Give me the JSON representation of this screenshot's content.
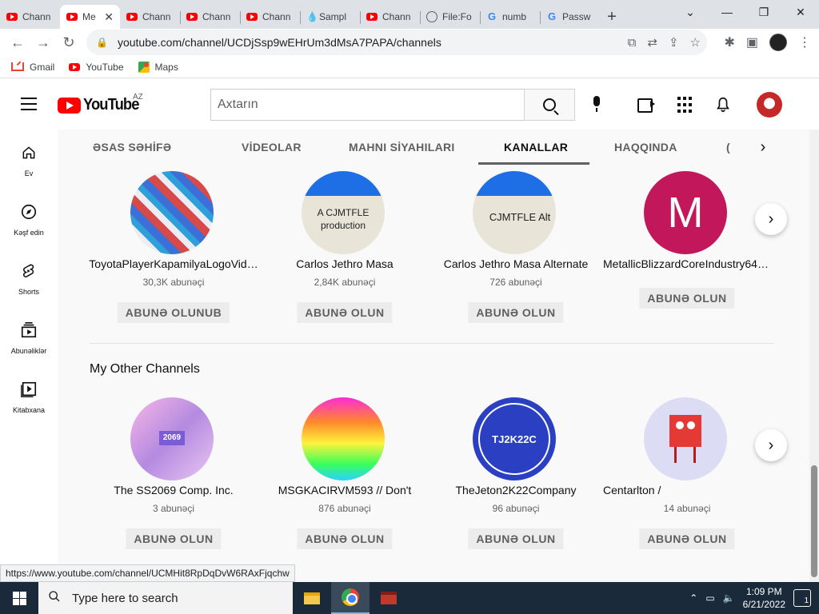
{
  "browser": {
    "tabs": [
      {
        "title": "Chann",
        "icon": "youtube-icon"
      },
      {
        "title": "Me",
        "icon": "youtube-icon",
        "active": true
      },
      {
        "title": "Chann",
        "icon": "youtube-icon"
      },
      {
        "title": "Chann",
        "icon": "youtube-icon"
      },
      {
        "title": "Chann",
        "icon": "youtube-icon"
      },
      {
        "title": "Sampl",
        "icon": "drop-icon"
      },
      {
        "title": "Chann",
        "icon": "youtube-icon"
      },
      {
        "title": "File:Fo",
        "icon": "globe-icon"
      },
      {
        "title": "numb",
        "icon": "google-icon"
      },
      {
        "title": "Passw",
        "icon": "google-icon"
      }
    ],
    "url": "youtube.com/channel/UCDjSsp9wEHrUm3dMsA7PAPA/channels",
    "bookmarks": [
      {
        "label": "Gmail"
      },
      {
        "label": "YouTube"
      },
      {
        "label": "Maps"
      }
    ],
    "status_url": "https://www.youtube.com/channel/UCMHit8RpDqDvW6RAxFjqchw"
  },
  "youtube": {
    "logo_text": "YouTube",
    "country_code": "AZ",
    "search_placeholder": "Axtarın",
    "sidebar": [
      {
        "label": "Ev",
        "icon": "home-icon"
      },
      {
        "label": "Kəşf edin",
        "icon": "compass-icon"
      },
      {
        "label": "Shorts",
        "icon": "shorts-icon"
      },
      {
        "label": "Abunəliklər",
        "icon": "subscriptions-icon"
      },
      {
        "label": "Kitabxana",
        "icon": "library-icon"
      }
    ],
    "channel_tabs": [
      {
        "label": "ƏSAS SƏHİFƏ"
      },
      {
        "label": "VİDEOLAR"
      },
      {
        "label": "MAHNI SİYAHILARI"
      },
      {
        "label": "KANALLAR",
        "active": true
      },
      {
        "label": "HAQQINDA"
      },
      {
        "label": "("
      }
    ],
    "featured_channels": [
      {
        "name": "ToyotaPlayerKapamilyaLogoVid…",
        "subs": "30,3K abunəçi",
        "button": "ABUNƏ OLUNUB",
        "thumb_text": ""
      },
      {
        "name": "Carlos Jethro Masa",
        "subs": "2,84K abunəçi",
        "button": "ABUNƏ OLUN",
        "thumb_text": "A CJMTFLE production"
      },
      {
        "name": "Carlos Jethro Masa Alternate",
        "subs": "726 abunəçi",
        "button": "ABUNƏ OLUN",
        "thumb_text": "CJMTFLE Alt"
      },
      {
        "name": "MetallicBlizzardCoreIndustry64…",
        "subs": "",
        "button": "ABUNƏ OLUN",
        "thumb_text": "M"
      }
    ],
    "other_section_title": "My Other Channels",
    "other_channels": [
      {
        "name": "The SS2069 Comp. Inc.",
        "subs": "3 abunəçi",
        "button": "ABUNƏ OLUN",
        "thumb_text": "2069"
      },
      {
        "name": "MSGKACIRVM593 // Don't",
        "subs": "876 abunəçi",
        "button": "ABUNƏ OLUN",
        "thumb_text": ""
      },
      {
        "name": "TheJeton2K22Company",
        "subs": "96 abunəçi",
        "button": "ABUNƏ OLUN",
        "thumb_text": "TJ2K22C"
      },
      {
        "name": "Centarlton /",
        "subs": "14 abunəçi",
        "button": "ABUNƏ OLUN",
        "thumb_text": ""
      }
    ]
  },
  "taskbar": {
    "search_placeholder": "Type here to search",
    "time": "1:09 PM",
    "date": "6/21/2022",
    "notification_count": "1"
  }
}
